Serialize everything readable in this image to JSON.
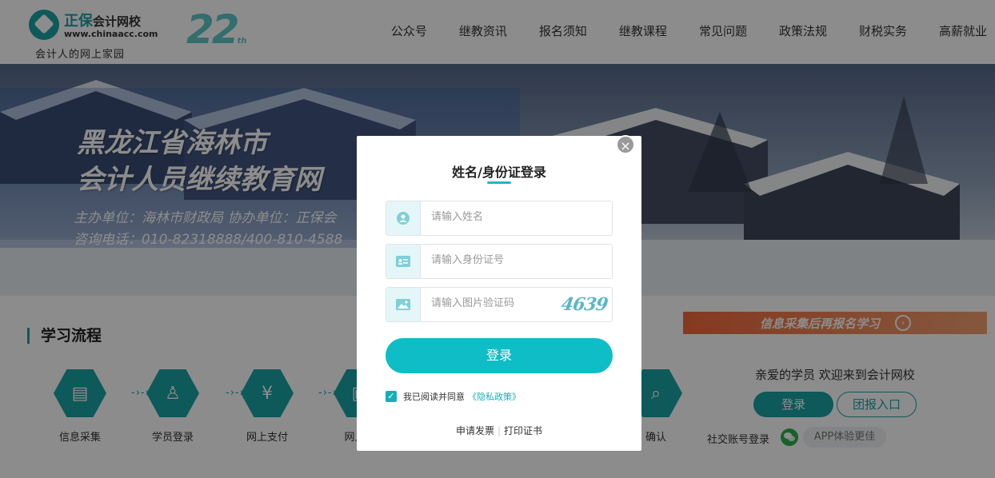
{
  "header": {
    "logo_brand": "正保",
    "logo_school": "会计网校",
    "logo_url": "www.chinaacc.com",
    "logo_slogan": "会计人的网上家园",
    "anniversary": "22",
    "anniversary_suffix": "th",
    "nav": [
      "公众号",
      "继教资讯",
      "报名须知",
      "继教课程",
      "常见问题",
      "政策法规",
      "财税实务",
      "高薪就业"
    ]
  },
  "banner": {
    "title_line1": "黑龙江省海林市",
    "title_line2": "会计人员继续教育网",
    "sub_line1": "主办单位：海林市财政局    协办单位：正保会",
    "sub_line2": "咨询电话：010-82318888/400-810-4588"
  },
  "process": {
    "title": "学习流程",
    "steps": [
      "信息采集",
      "学员登录",
      "网上支付",
      "网上学",
      "确认"
    ],
    "step_icons": [
      "form-icon",
      "user-check-icon",
      "yuan-bag-icon",
      "id-card-icon",
      "search-icon"
    ]
  },
  "sidebar": {
    "promo_text": "信息采集后再报名学习",
    "welcome": "亲爱的学员 欢迎来到会计网校",
    "login_label": "登录",
    "group_label": "团报入口",
    "social_label": "社交账号登录",
    "app_label": "APP体验更佳"
  },
  "modal": {
    "title": "姓名/身份证登录",
    "name_placeholder": "请输入姓名",
    "id_placeholder": "请输入身份证号",
    "captcha_placeholder": "请输入图片验证码",
    "captcha_code": "4639",
    "login_label": "登录",
    "agree_text": "我已阅读并同意",
    "policy_link": "《隐私政策》",
    "invoice_link": "申请发票",
    "separator": "|",
    "certificate_link": "打印证书",
    "close_symbol": "×"
  },
  "colors": {
    "accent": "#1aa3a5",
    "button": "#0fbdc6",
    "promo": "#f06a3c",
    "overlay": "rgba(0,0,0,0.45)"
  }
}
